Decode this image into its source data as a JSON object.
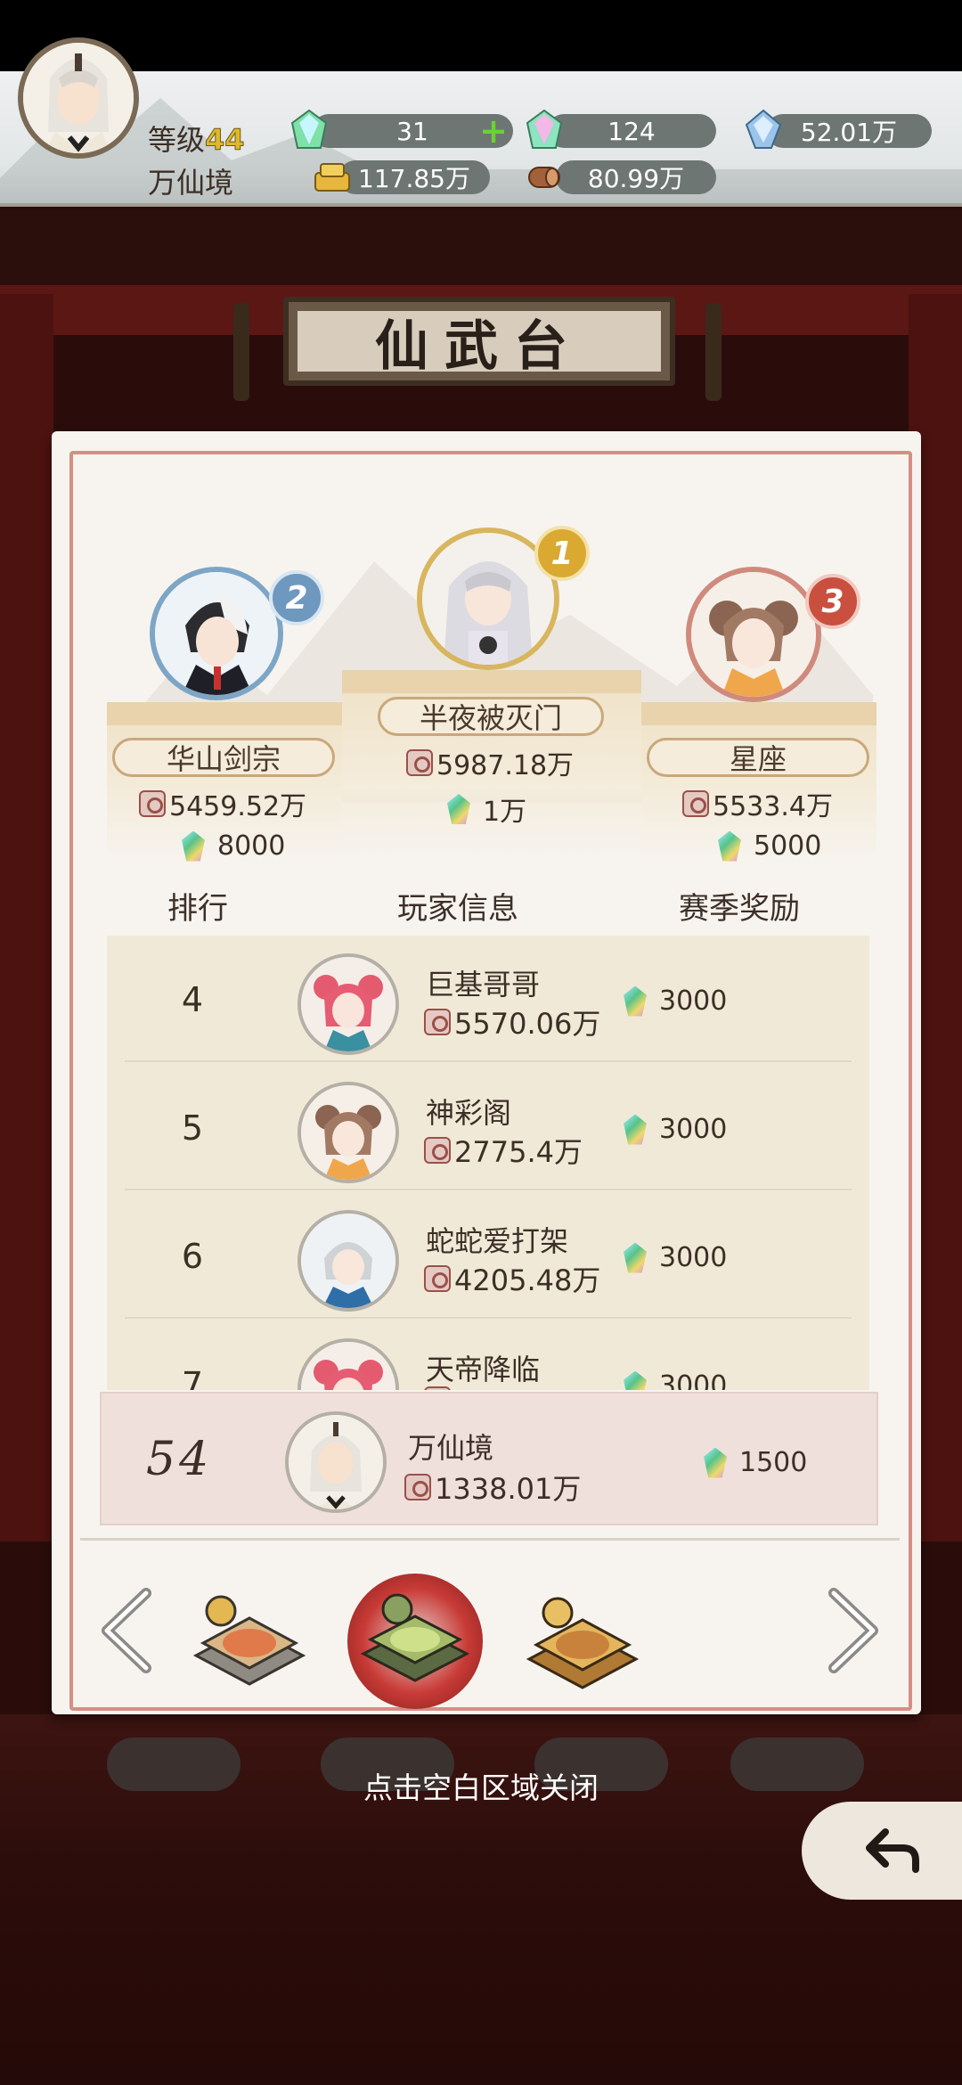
{
  "player": {
    "level_label": "等级",
    "level": "44",
    "realm": "万仙境"
  },
  "resources": {
    "gem_green": "31",
    "gem_pink": "124",
    "crystal": "52.01万",
    "gold": "117.85万",
    "wood": "80.99万"
  },
  "stage_title": "仙武台",
  "podium": [
    {
      "rank": "1",
      "name": "半夜被灭门",
      "power": "5987.18万",
      "reward": "1万"
    },
    {
      "rank": "2",
      "name": "华山剑宗",
      "power": "5459.52万",
      "reward": "8000"
    },
    {
      "rank": "3",
      "name": "星座",
      "power": "5533.4万",
      "reward": "5000"
    }
  ],
  "table_headers": {
    "rank": "排行",
    "info": "玩家信息",
    "reward": "赛季奖励"
  },
  "rows": [
    {
      "rank": "4",
      "name": "巨基哥哥",
      "power": "5570.06万",
      "reward": "3000"
    },
    {
      "rank": "5",
      "name": "神彩阁",
      "power": "2775.4万",
      "reward": "3000"
    },
    {
      "rank": "6",
      "name": "蛇蛇爱打架",
      "power": "4205.48万",
      "reward": "3000"
    },
    {
      "rank": "7",
      "name": "天帝降临",
      "power": "",
      "reward": "3000"
    }
  ],
  "me": {
    "rank": "54",
    "name": "万仙境",
    "power": "1338.01万",
    "reward": "1500"
  },
  "close_hint": "点击空白区域关闭",
  "colors": {
    "accent_red": "#c83a36",
    "panel": "#f7f4ef",
    "gold": "#e0b728"
  }
}
